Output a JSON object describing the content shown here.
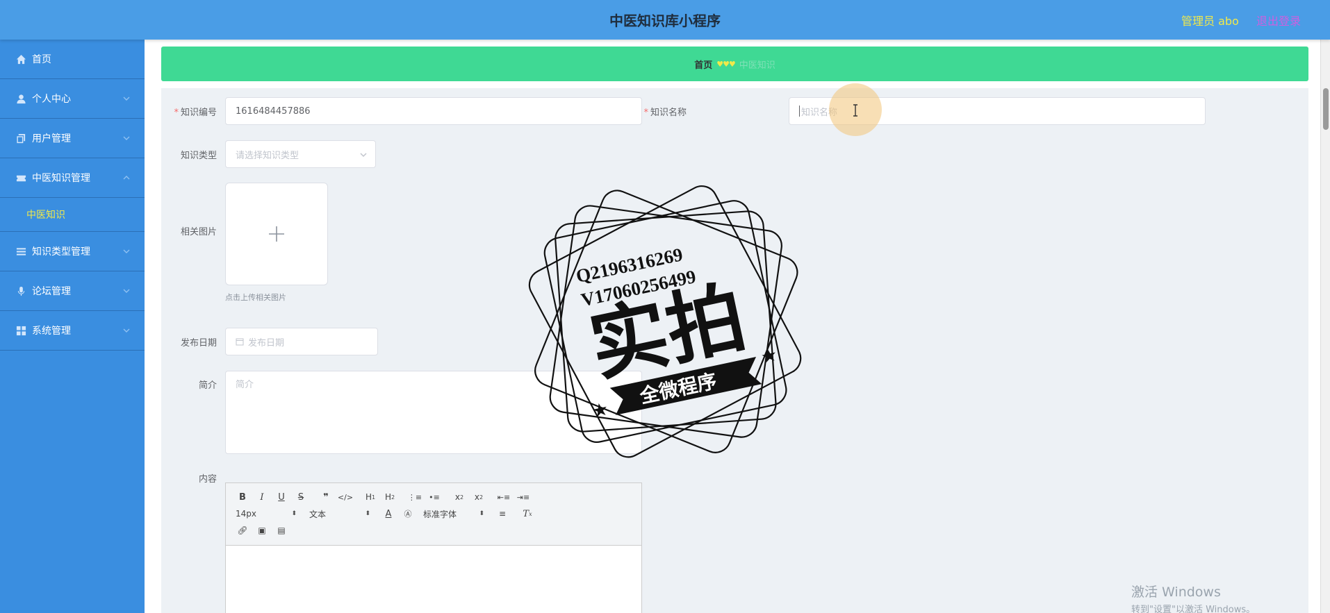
{
  "header": {
    "title": "中医知识库小程序",
    "admin_label": "管理员 abo",
    "logout_label": "退出登录"
  },
  "sidebar": {
    "items": [
      {
        "label": "首页",
        "icon": "home-icon"
      },
      {
        "label": "个人中心",
        "icon": "person-icon"
      },
      {
        "label": "用户管理",
        "icon": "copy-icon"
      },
      {
        "label": "中医知识管理",
        "icon": "ticket-icon",
        "expanded": true
      },
      {
        "label": "知识类型管理",
        "icon": "list-icon"
      },
      {
        "label": "论坛管理",
        "icon": "mic-icon"
      },
      {
        "label": "系统管理",
        "icon": "grid-icon"
      }
    ],
    "submenu": {
      "label": "中医知识"
    }
  },
  "breadcrumb": {
    "home": "首页",
    "separator": "♥♥♥",
    "current": "中医知识"
  },
  "form": {
    "code_label": "知识编号",
    "code_value": "1616484457886",
    "name_label": "知识名称",
    "name_placeholder": "知识名称",
    "type_label": "知识类型",
    "type_placeholder": "请选择知识类型",
    "image_label": "相关图片",
    "image_tip": "点击上传相关图片",
    "date_label": "发布日期",
    "date_placeholder": "发布日期",
    "intro_label": "简介",
    "intro_placeholder": "简介",
    "content_label": "内容"
  },
  "editor": {
    "font_size": "14px",
    "heading": "文本",
    "font_family": "标准字体"
  },
  "watermark": {
    "line1": "Q2196316269",
    "line2": "V17060256499",
    "main": "实拍",
    "banner": "全微程序"
  },
  "windows": {
    "line1": "激活 Windows",
    "line2": "转到\"设置\"以激活 Windows。"
  },
  "colors": {
    "header": "#4a9de6",
    "sidebar": "#3a8ee0",
    "breadcrumb": "#3fd994",
    "accent_yellow": "#f1e94a",
    "logout": "#cf5fe0"
  }
}
